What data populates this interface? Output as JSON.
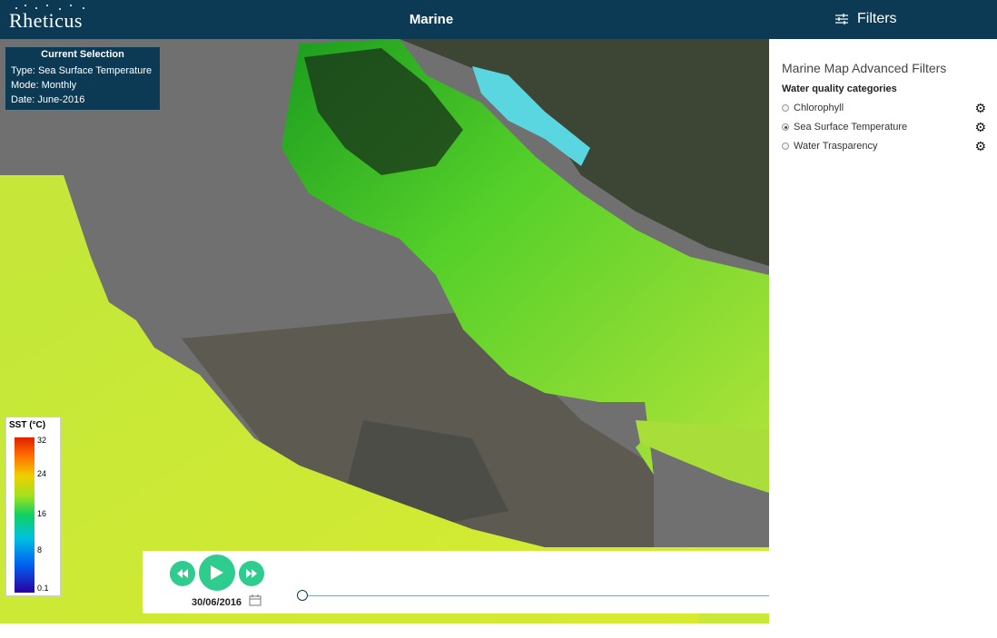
{
  "header": {
    "logo_text": "Rheticus",
    "title": "Marine",
    "filters_label": "Filters",
    "filters_icon": "sliders-icon"
  },
  "current_selection": {
    "title": "Current Selection",
    "type_line": "Type: Sea Surface Temperature",
    "mode_line": "Mode: Monthly",
    "date_line": "Date: June-2016"
  },
  "legend": {
    "title": "SST (°C)",
    "ticks": [
      "32",
      "24",
      "16",
      "8",
      "0.1"
    ]
  },
  "player": {
    "rewind_icon": "rewind-icon",
    "play_icon": "play-icon",
    "forward_icon": "fast-forward-icon",
    "date": "30/06/2016",
    "calendar_icon": "calendar-icon",
    "slider_position": 0
  },
  "panel": {
    "title": "Marine Map Advanced Filters",
    "subtitle": "Water quality categories",
    "options": [
      {
        "label": "Chlorophyll",
        "selected": false
      },
      {
        "label": "Sea Surface Temperature",
        "selected": true
      },
      {
        "label": "Water Trasparency",
        "selected": false
      }
    ],
    "settings_icon": "gear-icon"
  },
  "colors": {
    "header_bg": "#0c3a55",
    "accent_green": "#2ecc8f"
  }
}
